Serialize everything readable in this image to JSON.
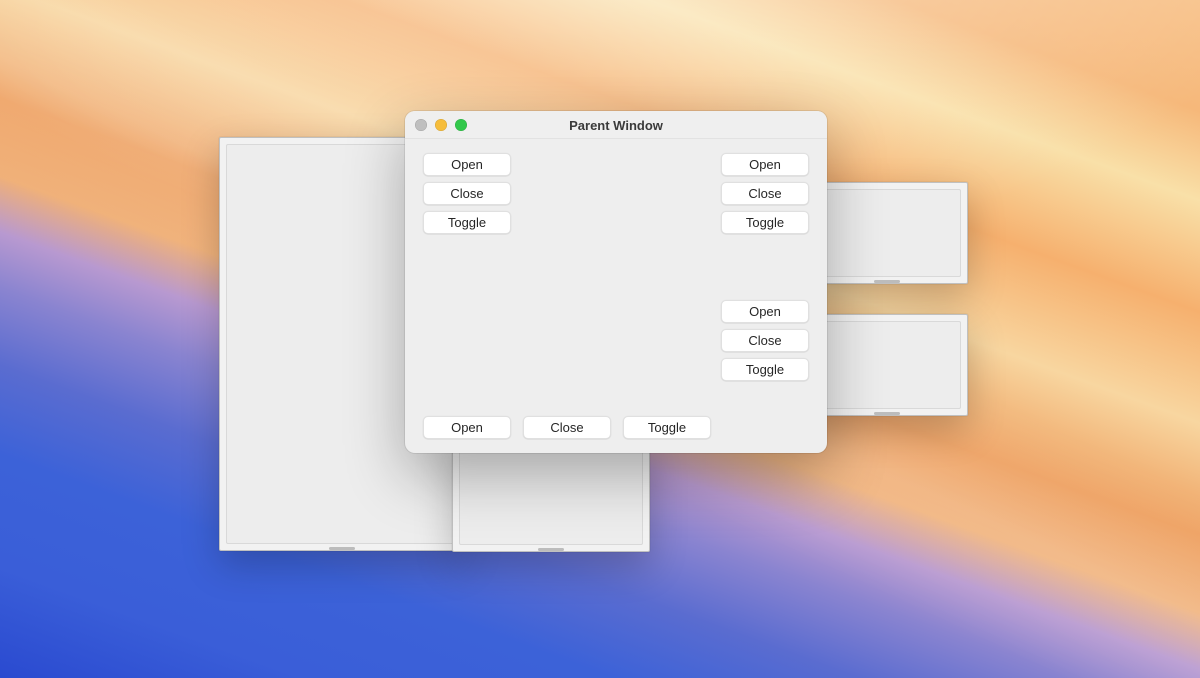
{
  "parent_window": {
    "title": "Parent Window",
    "groups": {
      "top_left": {
        "open": "Open",
        "close": "Close",
        "toggle": "Toggle"
      },
      "top_right": {
        "open": "Open",
        "close": "Close",
        "toggle": "Toggle"
      },
      "mid_right": {
        "open": "Open",
        "close": "Close",
        "toggle": "Toggle"
      },
      "bottom_row": {
        "open": "Open",
        "close": "Close",
        "toggle": "Toggle"
      }
    }
  }
}
